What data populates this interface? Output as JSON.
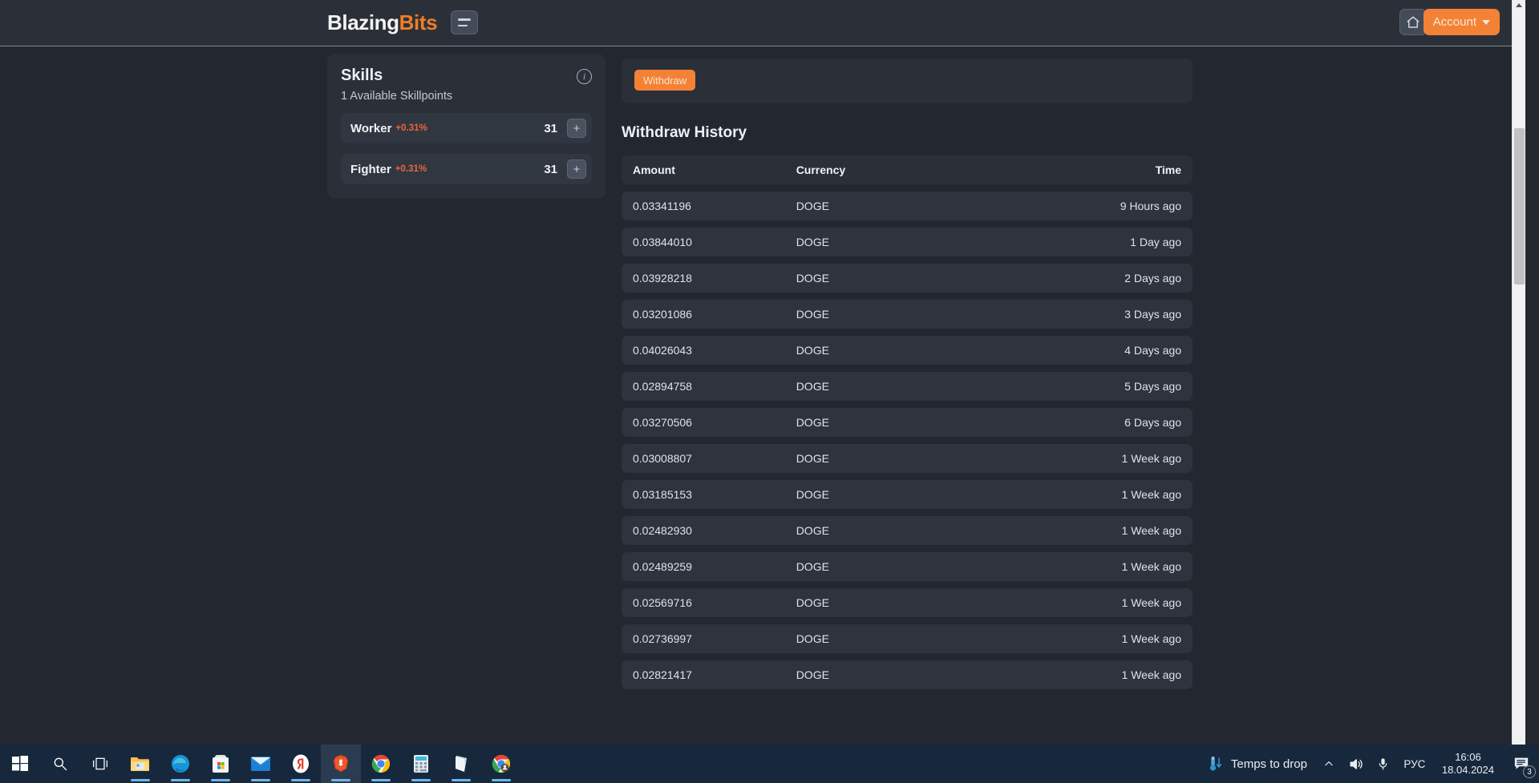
{
  "header": {
    "brand_first": "Blazing",
    "brand_second": "Bits",
    "menu_icon": "hamburger-icon",
    "home_icon": "home-icon",
    "account_label": "Account"
  },
  "skills": {
    "title": "Skills",
    "info_icon": "info-icon",
    "subtitle": "1 Available Skillpoints",
    "rows": [
      {
        "name": "Worker",
        "bonus": "+0.31%",
        "value": "31",
        "add": "+"
      },
      {
        "name": "Fighter",
        "bonus": "+0.31%",
        "value": "31",
        "add": "+"
      }
    ]
  },
  "withdraw": {
    "button_label": "Withdraw",
    "history_title": "Withdraw History",
    "columns": {
      "amount": "Amount",
      "currency": "Currency",
      "time": "Time"
    },
    "rows": [
      {
        "amount": "0.03341196",
        "currency": "DOGE",
        "time": "9 Hours ago"
      },
      {
        "amount": "0.03844010",
        "currency": "DOGE",
        "time": "1 Day ago"
      },
      {
        "amount": "0.03928218",
        "currency": "DOGE",
        "time": "2 Days ago"
      },
      {
        "amount": "0.03201086",
        "currency": "DOGE",
        "time": "3 Days ago"
      },
      {
        "amount": "0.04026043",
        "currency": "DOGE",
        "time": "4 Days ago"
      },
      {
        "amount": "0.02894758",
        "currency": "DOGE",
        "time": "5 Days ago"
      },
      {
        "amount": "0.03270506",
        "currency": "DOGE",
        "time": "6 Days ago"
      },
      {
        "amount": "0.03008807",
        "currency": "DOGE",
        "time": "1 Week ago"
      },
      {
        "amount": "0.03185153",
        "currency": "DOGE",
        "time": "1 Week ago"
      },
      {
        "amount": "0.02482930",
        "currency": "DOGE",
        "time": "1 Week ago"
      },
      {
        "amount": "0.02489259",
        "currency": "DOGE",
        "time": "1 Week ago"
      },
      {
        "amount": "0.02569716",
        "currency": "DOGE",
        "time": "1 Week ago"
      },
      {
        "amount": "0.02736997",
        "currency": "DOGE",
        "time": "1 Week ago"
      },
      {
        "amount": "0.02821417",
        "currency": "DOGE",
        "time": "1 Week ago"
      }
    ]
  },
  "taskbar": {
    "items": [
      {
        "icon": "windows-start-icon"
      },
      {
        "icon": "search-icon"
      },
      {
        "icon": "task-view-icon"
      },
      {
        "icon": "file-explorer-icon"
      },
      {
        "icon": "microsoft-edge-icon"
      },
      {
        "icon": "microsoft-store-icon"
      },
      {
        "icon": "mail-icon"
      },
      {
        "icon": "yandex-browser-icon"
      },
      {
        "icon": "brave-browser-icon"
      },
      {
        "icon": "google-chrome-icon"
      },
      {
        "icon": "calculator-icon"
      },
      {
        "icon": "sticky-notes-icon"
      },
      {
        "icon": "google-chrome-profile-icon"
      }
    ],
    "tray": {
      "weather_icon": "thermometer-icon",
      "weather_text": "Temps to drop",
      "chevron_icon": "chevron-up-icon",
      "volume_icon": "speaker-icon",
      "microphone_icon": "microphone-icon",
      "language": "РУС",
      "time": "16:06",
      "date": "18.04.2024",
      "notifications_icon": "notifications-icon",
      "notifications_count": "3"
    }
  },
  "colors": {
    "accent": "#f38236",
    "body_bg": "#23272f",
    "header_bg": "#2b3038",
    "card_bg": "#2a2f38",
    "row_bg": "#2e333d",
    "bonus": "#e8643f",
    "taskbar_bg": "#18283c"
  }
}
